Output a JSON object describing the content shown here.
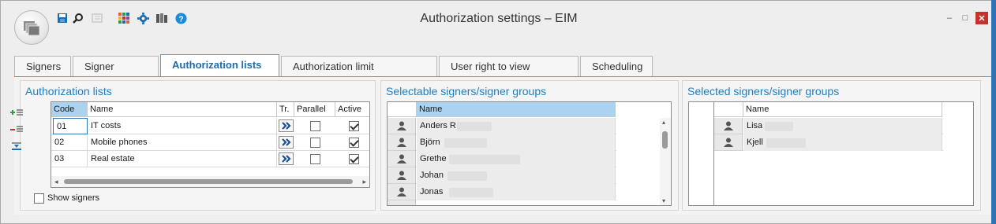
{
  "window": {
    "title": "Authorization settings – EIM",
    "controls": {
      "minimize": "–",
      "maximize": "□",
      "close": "✕"
    }
  },
  "toolbar": {
    "items": [
      {
        "name": "save-icon",
        "color": "#1d6cb1"
      },
      {
        "name": "search-icon",
        "color": "#222222"
      },
      {
        "name": "view-icon",
        "color": "#c8c8c8"
      },
      {
        "name": "apps-grid-icon",
        "color": "#e0642c"
      },
      {
        "name": "settings-gear-icon",
        "color": "#1d6cb1"
      },
      {
        "name": "library-icon",
        "color": "#555555"
      },
      {
        "name": "help-icon",
        "color": "#1d8ad8"
      }
    ]
  },
  "tabs": [
    {
      "label": "Signers",
      "active": false
    },
    {
      "label": "Signer groups",
      "active": false
    },
    {
      "label": "Authorization lists",
      "active": true
    },
    {
      "label": "Authorization limit exceptions",
      "active": false
    },
    {
      "label": "User right to view invoices",
      "active": false
    },
    {
      "label": "Scheduling",
      "active": false
    }
  ],
  "auth_lists": {
    "title": "Authorization lists",
    "columns": {
      "code": "Code",
      "name": "Name",
      "tr": "Tr.",
      "parallel": "Parallel",
      "active": "Active"
    },
    "rows": [
      {
        "code": "01",
        "name": "IT costs",
        "parallel": false,
        "active": true
      },
      {
        "code": "02",
        "name": "Mobile phones",
        "parallel": false,
        "active": true
      },
      {
        "code": "03",
        "name": "Real estate",
        "parallel": false,
        "active": true
      }
    ],
    "show_signers_label": "Show signers",
    "show_signers_checked": false
  },
  "selectable": {
    "title": "Selectable signers/signer groups",
    "column_name": "Name",
    "rows": [
      {
        "name": "Anders R"
      },
      {
        "name": "Björn"
      },
      {
        "name": "Grethe"
      },
      {
        "name": "Johan"
      },
      {
        "name": "Jonas"
      }
    ]
  },
  "selected": {
    "title": "Selected signers/signer groups",
    "column_name": "Name",
    "rows": [
      {
        "name": "Lisa"
      },
      {
        "name": "Kjell"
      }
    ]
  },
  "colors": {
    "accent": "#1b7fc4",
    "active_tab_border": "#5aa0d8",
    "header_selected": "#a9d3f0",
    "close_button": "#c9302c"
  }
}
